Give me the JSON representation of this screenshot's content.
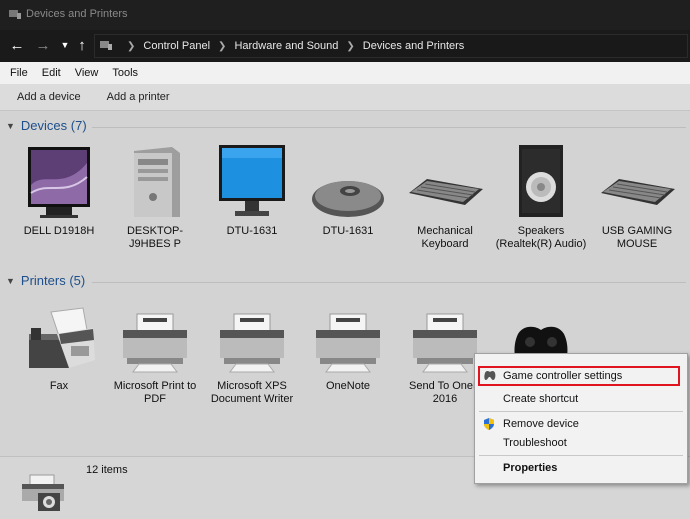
{
  "window": {
    "title": "Devices and Printers"
  },
  "address": {
    "crumbs": [
      "Control Panel",
      "Hardware and Sound",
      "Devices and Printers"
    ]
  },
  "menu": {
    "items": [
      "File",
      "Edit",
      "View",
      "Tools"
    ]
  },
  "commands": {
    "add_device": "Add a device",
    "add_printer": "Add a printer"
  },
  "devices": {
    "heading": "Devices (7)",
    "items": [
      "DELL D1918H",
      "DESKTOP-J9HBES P",
      "DTU-1631",
      "DTU-1631",
      "Mechanical Keyboard",
      "Speakers (Realtek(R) Audio)",
      "USB GAMING MOUSE"
    ]
  },
  "printers": {
    "heading": "Printers (5)",
    "items": [
      "Fax",
      "Microsoft Print to PDF",
      "Microsoft XPS Document Writer",
      "OneNote",
      "Send To OneN 2016"
    ]
  },
  "status": {
    "count": "12 items"
  },
  "context_menu": {
    "game_controller": "Game controller settings",
    "create_shortcut": "Create shortcut",
    "remove_device": "Remove device",
    "troubleshoot": "Troubleshoot",
    "properties": "Properties"
  },
  "colors": {
    "highlight": "#e0141e",
    "group_heading": "#1d4f8c",
    "titlebar": "#1f1f1f"
  }
}
